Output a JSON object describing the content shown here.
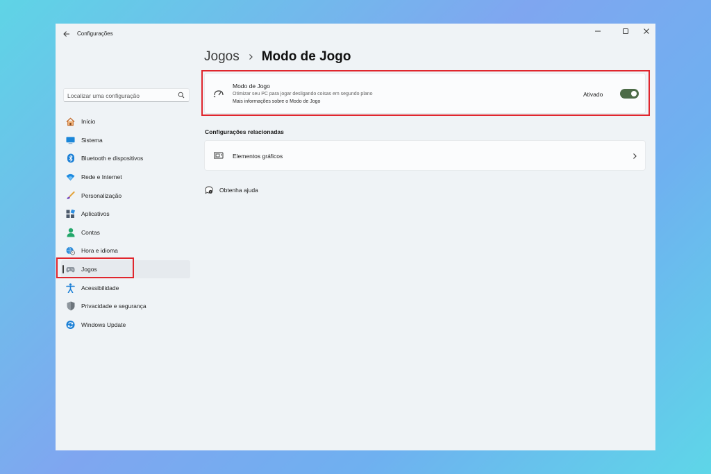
{
  "window": {
    "title": "Configurações",
    "controls": [
      "minimize-icon",
      "maximize-icon",
      "close-icon"
    ]
  },
  "search": {
    "placeholder": "Localizar uma configuração",
    "icon": "search-icon"
  },
  "sidebar": {
    "selected_index": 8,
    "items": [
      {
        "label": "Início",
        "icon": "home-icon"
      },
      {
        "label": "Sistema",
        "icon": "system-icon"
      },
      {
        "label": "Bluetooth e dispositivos",
        "icon": "bluetooth-icon"
      },
      {
        "label": "Rede e Internet",
        "icon": "wifi-icon"
      },
      {
        "label": "Personalização",
        "icon": "brush-icon"
      },
      {
        "label": "Aplicativos",
        "icon": "apps-icon"
      },
      {
        "label": "Contas",
        "icon": "person-icon"
      },
      {
        "label": "Hora e idioma",
        "icon": "globe-clock-icon"
      },
      {
        "label": "Jogos",
        "icon": "gamepad-icon"
      },
      {
        "label": "Acessibilidade",
        "icon": "accessibility-icon"
      },
      {
        "label": "Privacidade e segurança",
        "icon": "shield-icon"
      },
      {
        "label": "Windows Update",
        "icon": "update-icon"
      }
    ]
  },
  "breadcrumb": {
    "parent": "Jogos",
    "current": "Modo de Jogo"
  },
  "game_mode": {
    "title": "Modo de Jogo",
    "description": "Otimizar seu PC para jogar desligando coisas em segundo plano",
    "link": "Mais informações sobre o Modo de Jogo",
    "state_label": "Ativado",
    "enabled": true,
    "icon": "game-mode-icon"
  },
  "related": {
    "title": "Configurações relacionadas",
    "items": [
      {
        "label": "Elementos gráficos",
        "icon": "graphics-card-icon"
      }
    ]
  },
  "help": {
    "label": "Obtenha ajuda",
    "icon": "help-icon"
  },
  "colors": {
    "accent": "#4c6b47",
    "highlight": "#e0262d",
    "window_bg": "#eff3f6"
  }
}
